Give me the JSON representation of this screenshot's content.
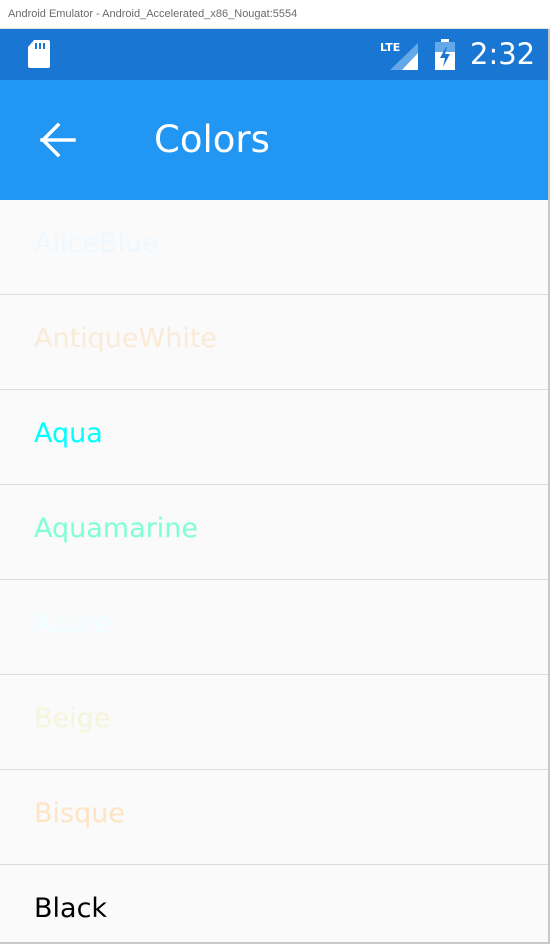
{
  "window": {
    "title": "Android Emulator - Android_Accelerated_x86_Nougat:5554"
  },
  "status_bar": {
    "time": "2:32",
    "network_label": "LTE",
    "icons": [
      "sd-card-icon",
      "lte-signal-icon",
      "battery-charging-icon"
    ],
    "background": "#1976d2"
  },
  "app_bar": {
    "title": "Colors",
    "back_icon": "arrow-left-icon",
    "background": "#2196f3"
  },
  "colors": [
    {
      "label": "AliceBlue",
      "color": "#f0f8ff"
    },
    {
      "label": "AntiqueWhite",
      "color": "#faebd7"
    },
    {
      "label": "Aqua",
      "color": "#00ffff"
    },
    {
      "label": "Aquamarine",
      "color": "#7fffd4"
    },
    {
      "label": "Azure",
      "color": "#f0ffff"
    },
    {
      "label": "Beige",
      "color": "#f5f5dc"
    },
    {
      "label": "Bisque",
      "color": "#ffe4c4"
    },
    {
      "label": "Black",
      "color": "#000000"
    }
  ]
}
